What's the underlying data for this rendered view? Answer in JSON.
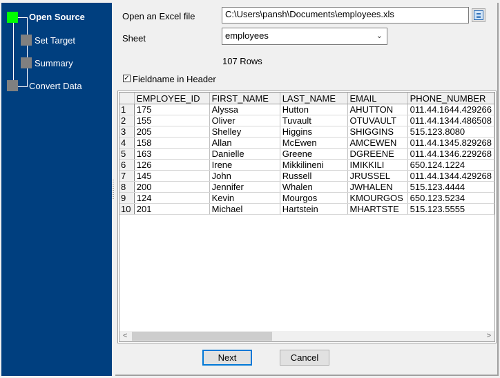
{
  "sidebar": {
    "steps": [
      {
        "label": "Open Source",
        "state": "active"
      },
      {
        "label": "Set Target",
        "state": "pending"
      },
      {
        "label": "Summary",
        "state": "pending"
      },
      {
        "label": "Convert Data",
        "state": "pending"
      }
    ],
    "colors": {
      "background": "#003f7f",
      "active": "#00ff00",
      "pending": "#808080"
    }
  },
  "form": {
    "file_label": "Open an Excel file",
    "file_value": "C:\\Users\\pansh\\Documents\\employees.xls",
    "browse_icon": "open-file-icon",
    "sheet_label": "Sheet",
    "sheet_value": "employees",
    "rows_text": "107 Rows",
    "header_checkbox_label": "Fieldname in Header",
    "header_checked": true
  },
  "grid": {
    "columns": [
      "EMPLOYEE_ID",
      "FIRST_NAME",
      "LAST_NAME",
      "EMAIL",
      "PHONE_NUMBER"
    ],
    "rows": [
      [
        "1",
        "175",
        "Alyssa",
        "Hutton",
        "AHUTTON",
        "011.44.1644.429266"
      ],
      [
        "2",
        "155",
        "Oliver",
        "Tuvault",
        "OTUVAULT",
        "011.44.1344.486508"
      ],
      [
        "3",
        "205",
        "Shelley",
        "Higgins",
        "SHIGGINS",
        "515.123.8080"
      ],
      [
        "4",
        "158",
        "Allan",
        "McEwen",
        "AMCEWEN",
        "011.44.1345.829268"
      ],
      [
        "5",
        "163",
        "Danielle",
        "Greene",
        "DGREENE",
        "011.44.1346.229268"
      ],
      [
        "6",
        "126",
        "Irene",
        "Mikkilineni",
        "IMIKKILI",
        "650.124.1224"
      ],
      [
        "7",
        "145",
        "John",
        "Russell",
        "JRUSSEL",
        "011.44.1344.429268"
      ],
      [
        "8",
        "200",
        "Jennifer",
        "Whalen",
        "JWHALEN",
        "515.123.4444"
      ],
      [
        "9",
        "124",
        "Kevin",
        "Mourgos",
        "KMOURGOS",
        "650.123.5234"
      ],
      [
        "10",
        "201",
        "Michael",
        "Hartstein",
        "MHARTSTE",
        "515.123.5555"
      ]
    ],
    "scroll_left_icon": "<",
    "scroll_right_icon": ">"
  },
  "buttons": {
    "next": "Next",
    "cancel": "Cancel"
  }
}
